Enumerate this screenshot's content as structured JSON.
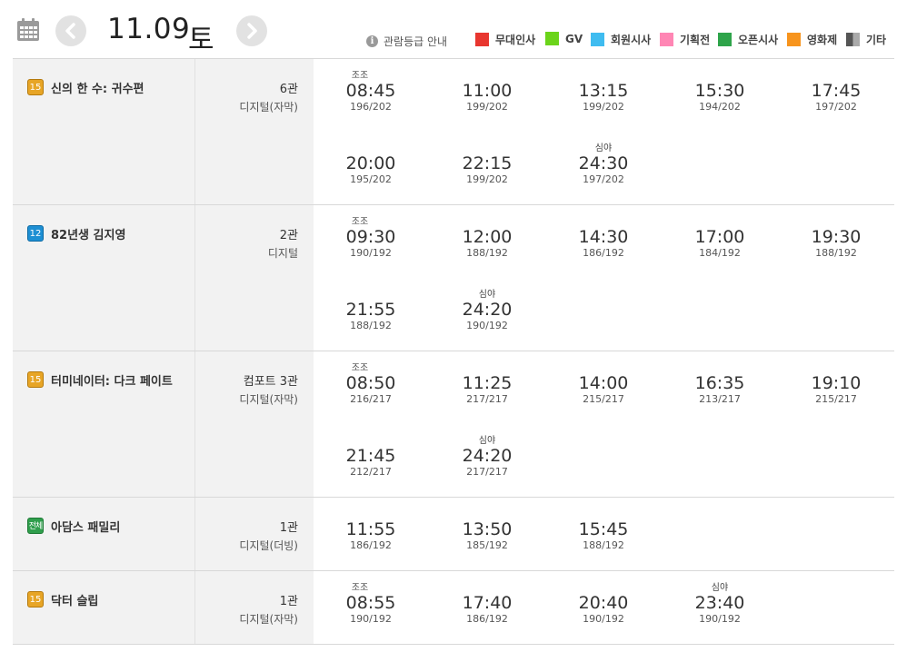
{
  "header": {
    "date": "11.09",
    "day": "토",
    "rating_info": "관람등급 안내",
    "legend": [
      {
        "label": "무대인사",
        "color": "#e8362f"
      },
      {
        "label": "GV",
        "color": "#6bd41a"
      },
      {
        "label": "회원시사",
        "color": "#3fbcf0"
      },
      {
        "label": "기획전",
        "color": "#ff86b4"
      },
      {
        "label": "오픈시사",
        "color": "#2ea44a"
      },
      {
        "label": "영화제",
        "color": "#f7941d"
      },
      {
        "label": "기타",
        "color": "#777777"
      }
    ]
  },
  "movies": [
    {
      "rating": "15",
      "title": "신의 한 수: 귀수편",
      "hall": "6관",
      "format": "디지털(자막)",
      "showtimes": [
        {
          "tag": "조조",
          "time": "08:45",
          "seats": "196/202"
        },
        {
          "tag": "",
          "time": "11:00",
          "seats": "199/202"
        },
        {
          "tag": "",
          "time": "13:15",
          "seats": "199/202"
        },
        {
          "tag": "",
          "time": "15:30",
          "seats": "194/202"
        },
        {
          "tag": "",
          "time": "17:45",
          "seats": "197/202"
        },
        {
          "tag": "",
          "time": "20:00",
          "seats": "195/202"
        },
        {
          "tag": "",
          "time": "22:15",
          "seats": "199/202"
        },
        {
          "tag": "심야",
          "time": "24:30",
          "seats": "197/202"
        }
      ]
    },
    {
      "rating": "12",
      "title": "82년생 김지영",
      "hall": "2관",
      "format": "디지털",
      "showtimes": [
        {
          "tag": "조조",
          "time": "09:30",
          "seats": "190/192"
        },
        {
          "tag": "",
          "time": "12:00",
          "seats": "188/192"
        },
        {
          "tag": "",
          "time": "14:30",
          "seats": "186/192"
        },
        {
          "tag": "",
          "time": "17:00",
          "seats": "184/192"
        },
        {
          "tag": "",
          "time": "19:30",
          "seats": "188/192"
        },
        {
          "tag": "",
          "time": "21:55",
          "seats": "188/192"
        },
        {
          "tag": "심야",
          "time": "24:20",
          "seats": "190/192"
        }
      ]
    },
    {
      "rating": "15",
      "title": "터미네이터: 다크 페이트",
      "hall": "컴포트 3관",
      "format": "디지털(자막)",
      "showtimes": [
        {
          "tag": "조조",
          "time": "08:50",
          "seats": "216/217"
        },
        {
          "tag": "",
          "time": "11:25",
          "seats": "217/217"
        },
        {
          "tag": "",
          "time": "14:00",
          "seats": "215/217"
        },
        {
          "tag": "",
          "time": "16:35",
          "seats": "213/217"
        },
        {
          "tag": "",
          "time": "19:10",
          "seats": "215/217"
        },
        {
          "tag": "",
          "time": "21:45",
          "seats": "212/217"
        },
        {
          "tag": "심야",
          "time": "24:20",
          "seats": "217/217"
        }
      ]
    },
    {
      "rating": "전체",
      "title": "아담스 패밀리",
      "hall": "1관",
      "format": "디지털(더빙)",
      "showtimes": [
        {
          "tag": "",
          "time": "11:55",
          "seats": "186/192"
        },
        {
          "tag": "",
          "time": "13:50",
          "seats": "185/192"
        },
        {
          "tag": "",
          "time": "15:45",
          "seats": "188/192"
        }
      ]
    },
    {
      "rating": "15",
      "title": "닥터 슬립",
      "hall": "1관",
      "format": "디지털(자막)",
      "showtimes": [
        {
          "tag": "조조",
          "time": "08:55",
          "seats": "190/192"
        },
        {
          "tag": "",
          "time": "17:40",
          "seats": "186/192"
        },
        {
          "tag": "",
          "time": "20:40",
          "seats": "190/192"
        },
        {
          "tag": "심야",
          "time": "23:40",
          "seats": "190/192"
        }
      ]
    }
  ]
}
